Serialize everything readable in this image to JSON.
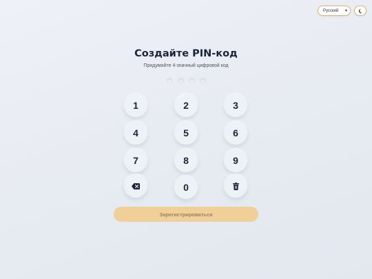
{
  "header": {
    "language_select_value": "Русский",
    "theme_toggle_icon": "moon-icon"
  },
  "main": {
    "title": "Создайте PIN-код",
    "subtitle": "Придумайте 4-значный цифровой код",
    "pin_length": 4,
    "pin_filled": 0
  },
  "keypad": {
    "keys": [
      "1",
      "2",
      "3",
      "4",
      "5",
      "6",
      "7",
      "8",
      "9",
      "0"
    ],
    "backspace_icon": "backspace-icon",
    "clear_icon": "trash-icon"
  },
  "actions": {
    "register_label": "Зарегистрироваться"
  },
  "colors": {
    "accent": "#f0cf99",
    "accent_border": "#e2b46b",
    "text": "#1b2438"
  }
}
